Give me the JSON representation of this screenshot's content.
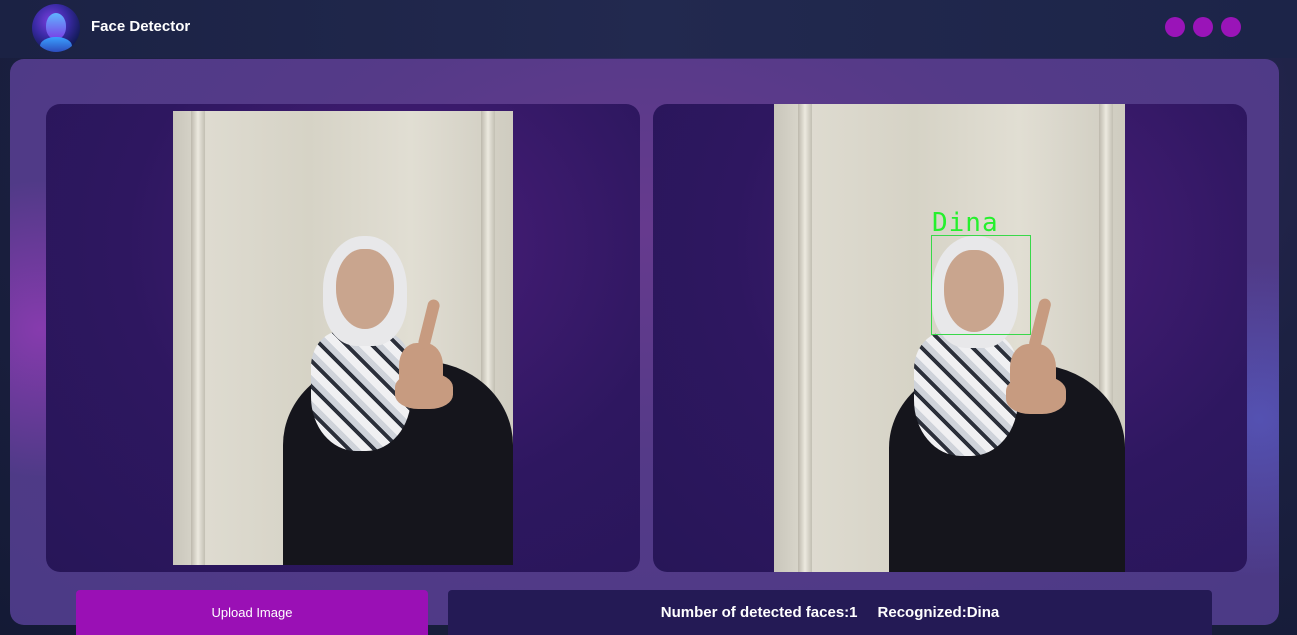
{
  "header": {
    "title": "Face Detector",
    "logo_icon": "face-logo-icon",
    "window_dots": [
      "dot",
      "dot",
      "dot"
    ],
    "dot_color": "#9a14b8"
  },
  "panels": {
    "left": {
      "image": "original-photo"
    },
    "right": {
      "image": "annotated-photo",
      "detection_label": "Dina",
      "box_color": "#39d84a"
    }
  },
  "actions": {
    "upload_label": "Upload Image"
  },
  "results": {
    "faces_text": "Number of detected faces:1",
    "recognized_text": "Recognized:Dina"
  },
  "colors": {
    "accent": "#9a10b5",
    "panel_bg": "#2e1760",
    "result_bg": "#241a55"
  }
}
